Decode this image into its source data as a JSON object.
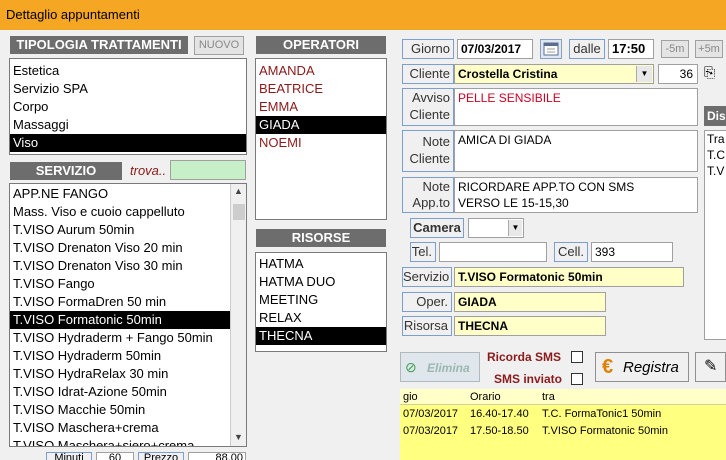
{
  "window": {
    "title": "Dettaglio appuntamenti"
  },
  "tipologia": {
    "header": "TIPOLOGIA TRATTAMENTI",
    "new_button": "NUOVO",
    "items": [
      "Estetica",
      "Servizio SPA",
      "Corpo",
      "Massaggi",
      "Viso"
    ],
    "selected_index": 4
  },
  "servizio": {
    "header": "SERVIZIO",
    "find_label": "trova..",
    "find_value": "",
    "items": [
      "APP.NE FANGO",
      "Mass. Viso e cuoio cappelluto",
      "T.VISO Aurum 50min",
      "T.VISO Drenaton Viso 20 min",
      "T.VISO Drenaton Viso 30 min",
      "T.VISO Fango",
      "T.VISO FormaDren 50 min",
      "T.VISO Formatonic 50min",
      "T.VISO Hydraderm + Fango 50min",
      "T.VISO Hydraderm 50min",
      "T.VISO HydraRelax 30 min",
      "T.VISO Idrat-Azione 50min",
      "T.VISO Macchie 50min",
      "T.VISO Maschera+crema",
      "T.VISO Maschera+siero+crema"
    ],
    "selected_index": 7,
    "footer_minuti_label": "Minuti",
    "footer_minuti_value": "60",
    "footer_prezzo_label": "Prezzo",
    "footer_prezzo_value": "88,00"
  },
  "operatori": {
    "header": "OPERATORI",
    "items": [
      "AMANDA",
      "BEATRICE",
      "EMMA",
      "GIADA",
      "NOEMI"
    ],
    "selected_index": 3
  },
  "risorse": {
    "header": "RISORSE",
    "items": [
      "HATMA",
      "HATMA DUO",
      "MEETING",
      "RELAX",
      "THECNA"
    ],
    "selected_index": 4
  },
  "form": {
    "giorno_label": "Giorno",
    "giorno_value": "07/03/2017",
    "dalle_label": "dalle",
    "dalle_value": "17:50",
    "minus5": "-5m",
    "plus5": "+5m",
    "cliente_label": "Cliente",
    "cliente_value": "Crostella Cristina",
    "cliente_num": "36",
    "avviso_label_1": "Avviso",
    "avviso_label_2": "Cliente",
    "avviso_value": "PELLE SENSIBILE",
    "note_cliente_label_1": "Note",
    "note_cliente_label_2": "Cliente",
    "note_cliente_value": "AMICA DI GIADA",
    "note_app_label_1": "Note",
    "note_app_label_2": "App.to",
    "note_app_line1": "RICORDARE APP.TO CON SMS",
    "note_app_line2": "VERSO LE 15-15,30",
    "camera_label": "Camera",
    "camera_value": "",
    "tel_label": "Tel.",
    "tel_value": "",
    "cell_label": "Cell.",
    "cell_value": "393",
    "servizio_label": "Servizio",
    "servizio_value": "T.VISO Formatonic 50min",
    "oper_label": "Oper.",
    "oper_value": "GIADA",
    "risorsa_label": "Risorsa",
    "risorsa_value": "THECNA"
  },
  "side": {
    "dis_label": "Dis",
    "tra_label": "Tra",
    "t1": "T.C",
    "t2": "T.V"
  },
  "actions": {
    "elimina": "Elimina",
    "ricorda_sms": "Ricorda SMS",
    "sms_inviato": "SMS inviato",
    "registra": "Registra"
  },
  "grid": {
    "headers": [
      "gio",
      "Orario",
      "tra"
    ],
    "rows": [
      [
        "07/03/2017",
        "16.40-17.40",
        "T.C. FormaTonic1 50min"
      ],
      [
        "07/03/2017",
        "17.50-18.50",
        "T.VISO Formatonic 50min"
      ]
    ]
  },
  "colors": {
    "titlebar": "#f5a623",
    "header_bg": "#6d6d6d",
    "yellow_field": "#ffffc8",
    "grid_row": "#ffff80"
  }
}
